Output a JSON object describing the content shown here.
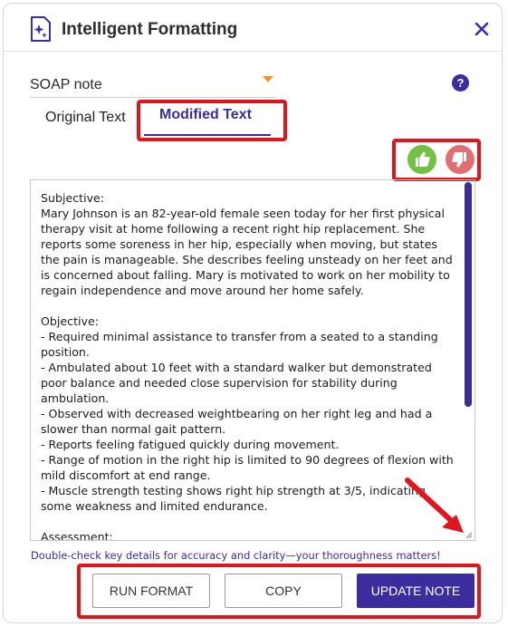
{
  "header": {
    "title": "Intelligent Formatting"
  },
  "format_select": {
    "value": "SOAP note"
  },
  "help": {
    "label": "?"
  },
  "tabs": [
    {
      "label": "Original Text",
      "active": false
    },
    {
      "label": "Modified Text",
      "active": true
    }
  ],
  "feedback": {
    "up_icon": "thumbs-up-icon",
    "down_icon": "thumbs-down-icon"
  },
  "note_text": "Subjective:\nMary Johnson is an 82-year-old female seen today for her first physical therapy visit at home following a recent right hip replacement. She reports some soreness in her hip, especially when moving, but states the pain is manageable. She describes feeling unsteady on her feet and is concerned about falling. Mary is motivated to work on her mobility to regain independence and move around her home safely.\n\nObjective:\n- Required minimal assistance to transfer from a seated to a standing position.\n- Ambulated about 10 feet with a standard walker but demonstrated poor balance and needed close supervision for stability during ambulation.\n- Observed with decreased weightbearing on her right leg and had a slower than normal gait pattern.\n- Reports feeling fatigued quickly during movement.\n- Range of motion in the right hip is limited to 90 degrees of flexion with mild discomfort at end range.\n- Muscle strength testing shows right hip strength at 3/5, indicating some weakness and limited endurance.\n\nAssessment:\nMary presents with decreased balance and strength following her right",
  "hint": "Double-check key details for accuracy and clarity—your thoroughness matters!",
  "buttons": {
    "run": "RUN FORMAT",
    "copy": "COPY",
    "update": "UPDATE NOTE"
  },
  "colors": {
    "accent": "#3c2d9e",
    "highlight": "#e0161e",
    "thumb_up": "#72c046",
    "thumb_down": "#e06f74",
    "caret": "#f0932b"
  }
}
